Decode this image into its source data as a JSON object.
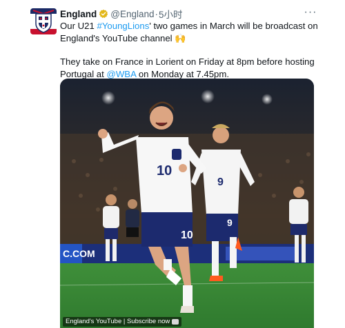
{
  "tweet": {
    "display_name": "England",
    "handle": "@England",
    "separator": "·",
    "time": "5小时",
    "more_icon": "more-horizontal-icon",
    "verified_color": "#e2b719",
    "text_line1_before": "Our U21 ",
    "hashtag": "#YoungLions",
    "text_line1_after": "' two games in March will be broadcast on England's YouTube channel 🙌",
    "text_line2_before": "They take on France in Lorient on Friday at 8pm before hosting Portugal at ",
    "mention": "@WBA",
    "text_line2_after": " on Monday at 7.45pm.",
    "link_color": "#1d9bf0"
  },
  "media": {
    "description_players": [
      "10",
      "9",
      "9",
      "10"
    ],
    "ad_board_text": "C.COM",
    "caption": "England's YouTube | Subscribe now"
  }
}
